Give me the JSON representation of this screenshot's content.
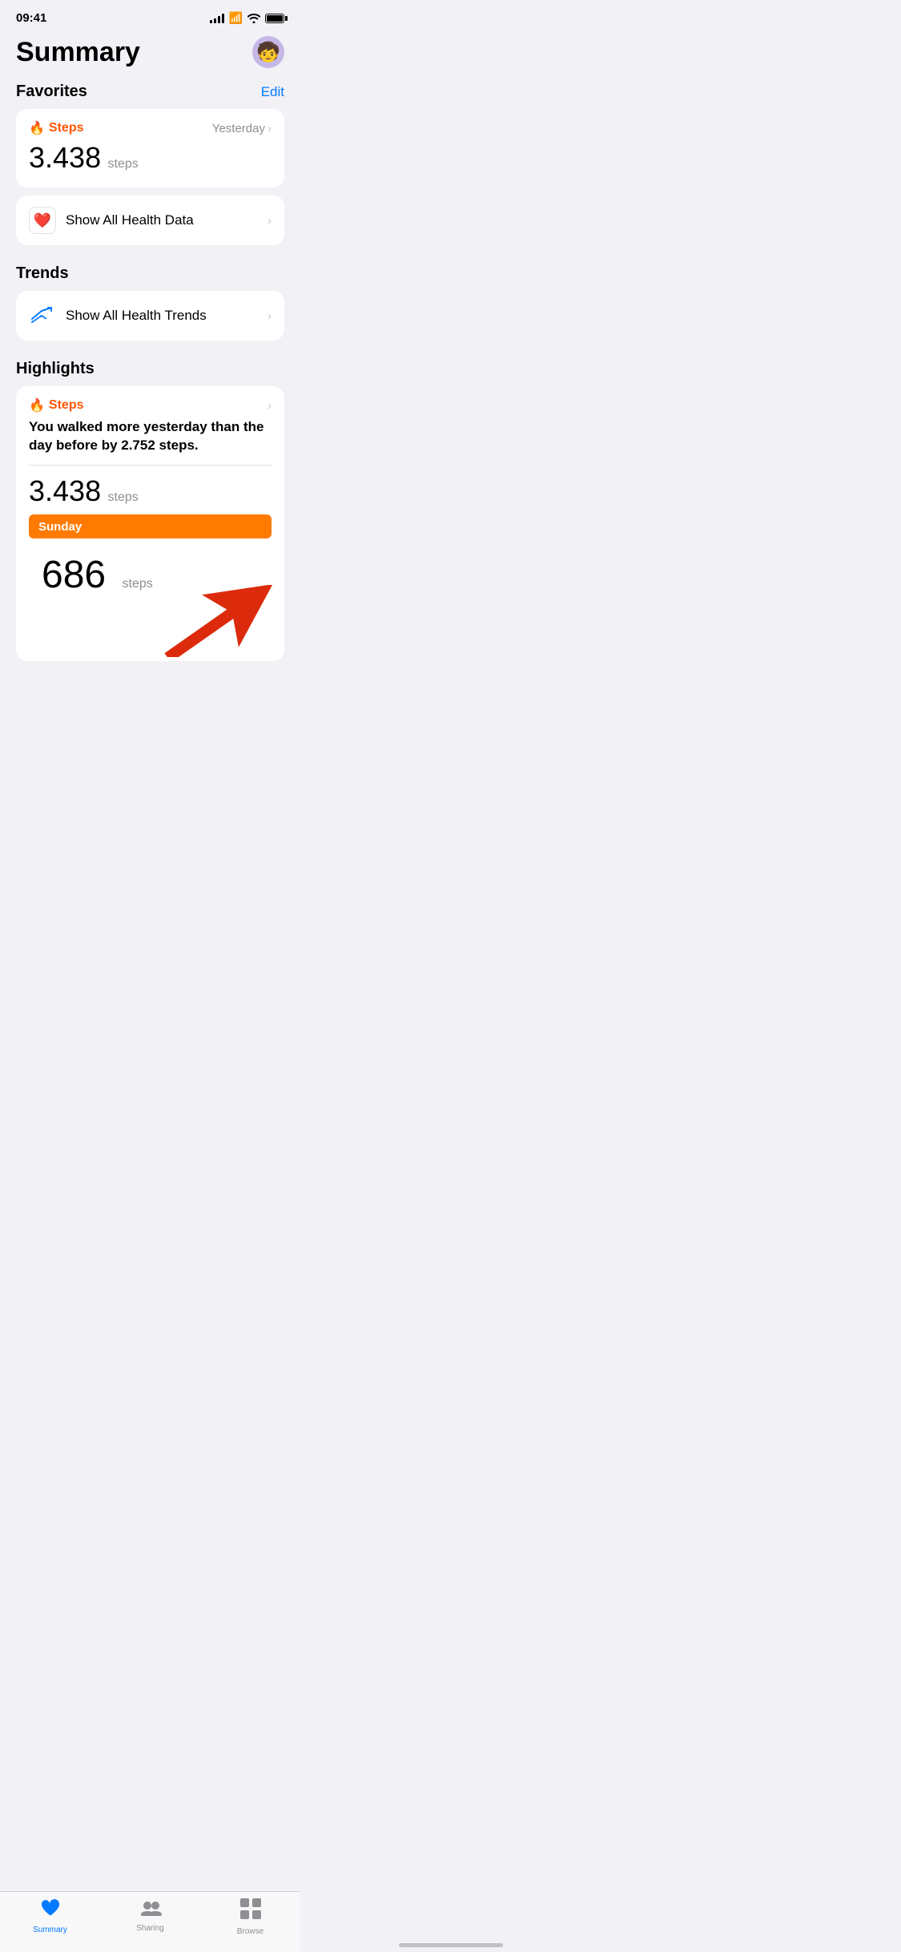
{
  "statusBar": {
    "time": "09:41",
    "battery": "full"
  },
  "pageTitle": "Summary",
  "avatar": {
    "emoji": "🧒"
  },
  "favorites": {
    "label": "Favorites",
    "editLabel": "Edit",
    "stepsCard": {
      "icon": "🔥",
      "label": "Steps",
      "period": "Yesterday",
      "value": "3.438",
      "unit": "steps"
    },
    "showAllCard": {
      "icon": "❤️",
      "label": "Show All Health Data"
    }
  },
  "trends": {
    "label": "Trends",
    "showAllCard": {
      "label": "Show All Health Trends"
    }
  },
  "highlights": {
    "label": "Highlights",
    "stepsCard": {
      "icon": "🔥",
      "label": "Steps",
      "description": "You walked more yesterday than the day before by 2.752 steps.",
      "value": "3.438",
      "unit": "steps",
      "barLabel": "Sunday",
      "partialValue": "686",
      "partialUnit": "steps"
    }
  },
  "tabBar": {
    "items": [
      {
        "id": "summary",
        "label": "Summary",
        "active": true
      },
      {
        "id": "sharing",
        "label": "Sharing",
        "active": false
      },
      {
        "id": "browse",
        "label": "Browse",
        "active": false
      }
    ]
  }
}
